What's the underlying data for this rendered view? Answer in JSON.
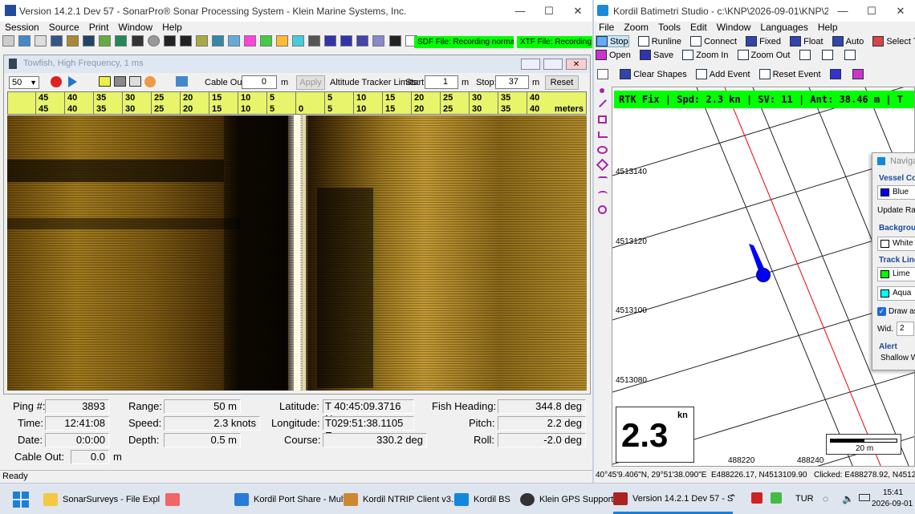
{
  "sonar": {
    "title": "Version 14.2.1 Dev 57 - SonarPro® Sonar Processing System - Klein Marine Systems, Inc.",
    "menu": [
      "Session",
      "Source",
      "Print",
      "Window",
      "Help"
    ],
    "sdf_status": "SDF File: Recording normally",
    "xtf_status": "XTF File: Recording no",
    "sub_title": "Towfish, High Frequency, 1 ms",
    "range_select": "50",
    "cable_out_label": "Cable Out:",
    "cable_out_value": "0",
    "unit_m": "m",
    "apply_label": "Apply",
    "altitude_label": "Altitude Tracker Limits:",
    "start_label": "Start:",
    "start_value": "1",
    "stop_label": "Stop:",
    "stop_value": "37",
    "reset_label": "Reset",
    "scale_left": [
      "45",
      "40",
      "35",
      "30",
      "25",
      "20",
      "15",
      "10",
      "5"
    ],
    "scale_right": [
      "5",
      "10",
      "15",
      "20",
      "25",
      "30",
      "35",
      "40"
    ],
    "scale_zero": "0",
    "scale_unit": "meters",
    "info": {
      "ping_label": "Ping #:",
      "ping": "3893",
      "time_label": "Time:",
      "time": "12:41:08",
      "date_label": "Date:",
      "date": "0:0:00",
      "cable_label": "Cable Out:",
      "cable": "0.0",
      "cable_unit": "m",
      "range_label": "Range:",
      "range": "50 m",
      "speed_label": "Speed:",
      "speed": "2.3 knots",
      "depth_label": "Depth:",
      "depth": "0.5 m",
      "lat_label": "Latitude:",
      "lat": "T  40:45:09.3716 N",
      "lon_label": "Longitude:",
      "lon": "T029:51:38.1105 E",
      "course_label": "Course:",
      "course": "330.2 deg",
      "heading_label": "Fish Heading:",
      "heading": "344.8 deg",
      "pitch_label": "Pitch:",
      "pitch": "2.2 deg",
      "roll_label": "Roll:",
      "roll": "-2.0 deg"
    },
    "status": "Ready"
  },
  "kordil": {
    "title": "Kordil Batimetri Studio - c:\\KNP\\2026-09-01\\KNP\\2026-0...",
    "menu": [
      "File",
      "Zoom",
      "Tools",
      "Edit",
      "Window",
      "Languages",
      "Help"
    ],
    "toolbar1": [
      "Stop",
      "Runline",
      "Connect",
      "Fixed",
      "Float",
      "Auto",
      "Select Tracks"
    ],
    "toolbar2": [
      "Open",
      "Save",
      "Zoom In",
      "Zoom Out"
    ],
    "toolbar3": [
      "Clear Shapes",
      "Add Event",
      "Reset Event"
    ],
    "rtk_banner": "RTK Fix  |  Spd: 2.3 kn  |  SV: 11  |  Ant: 38.46 m  |  T",
    "y_labels": [
      "4513140",
      "4513120",
      "4513100",
      "4513080"
    ],
    "x_labels": [
      "488220",
      "488240"
    ],
    "speed_big": "2.3",
    "speed_unit": "kn",
    "scale_text": "20 m",
    "status_left": "40°45'9.406\"N, 29°51'38.090\"E",
    "status_mid": "E488226.17, N4513109.90",
    "status_right": "Clicked: E488278.92, N45129",
    "nav_panel": {
      "title": "Naviga",
      "vessel_color_label": "Vessel Col",
      "vessel_color": "Blue",
      "update_label": "Update Rat",
      "background_label": "Backgrou",
      "background": "White",
      "track_label": "Track Line",
      "track1": "Lime",
      "track2": "Aqua",
      "draw_label": "Draw as",
      "width_label": "Wid.",
      "width_value": "2",
      "alert_label": "Alert",
      "shallow_label": "Shallow W"
    }
  },
  "taskbar": {
    "items": [
      "SonarSurveys - File Expl",
      "Kordil Port Share - Mult",
      "Kordil NTRIP Client v3.1",
      "Kordil BS",
      "Klein GPS Support",
      "Version 14.2.1 Dev 57 - S"
    ],
    "lang": "TUR",
    "time": "15:41",
    "date": "2026-09-01"
  },
  "colors": {
    "rtk_green": "#00ff00",
    "lime": "#00ff00",
    "aqua": "#00ffff",
    "vessel": "#0000ff",
    "scale_yellow": "#e8f46a"
  }
}
